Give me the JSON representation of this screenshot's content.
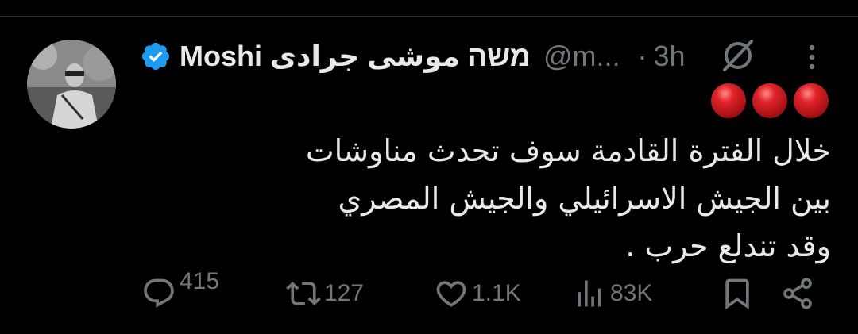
{
  "tweet": {
    "display_name": "Moshi משה موشى جرادى",
    "handle": "@m...",
    "separator": "·",
    "time": "3h",
    "emoji_icons": [
      "red-circle-icon",
      "red-circle-icon",
      "red-circle-icon"
    ],
    "text_lines": [
      "خلال الفترة القادمة سوف تحدث مناوشات",
      "بين الجيش الاسرائيلي والجيش المصري",
      "وقد تندلع حرب ."
    ]
  },
  "actions": {
    "replies": "415",
    "reposts": "127",
    "likes": "1.1K",
    "views": "83K"
  },
  "colors": {
    "background": "#000000",
    "text": "#e7e9ea",
    "muted": "#71767b",
    "verified": "#1d9bf0",
    "emoji_red": "#e0242b"
  }
}
